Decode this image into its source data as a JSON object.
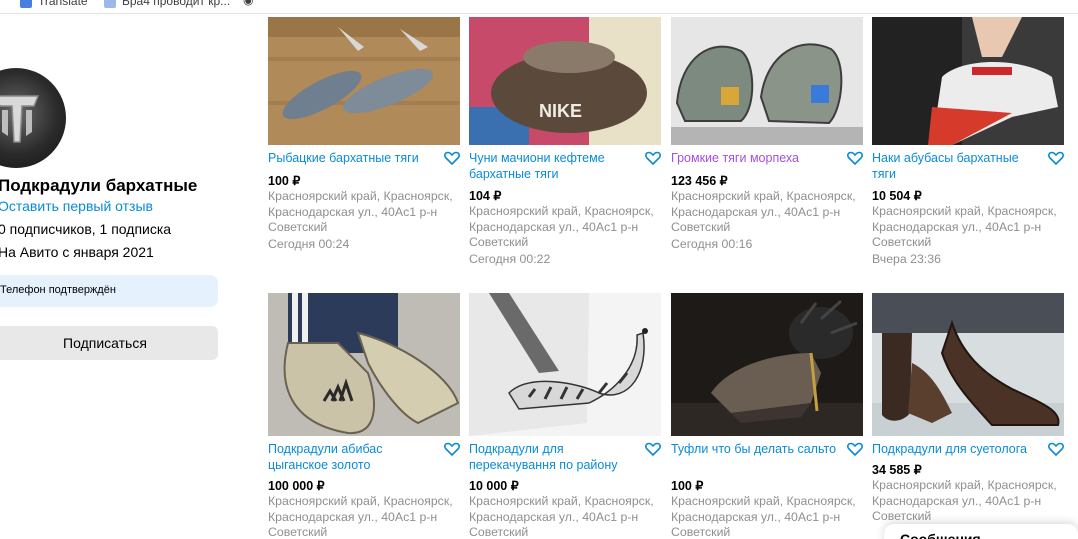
{
  "bookmarks": [
    "Translate",
    "Бра4 проводит кр..."
  ],
  "seller": {
    "name": "Подкрадули бархатные",
    "review_link": "Оставить первый отзыв",
    "followers": "0 подписчиков, 1 подписка",
    "since": "На Авито с января 2021",
    "phone_badge": "Телефон подтверждён",
    "subscribe_label": "Подписаться"
  },
  "colors": {
    "link": "#0a8bd8",
    "visited": "#a44fe0",
    "muted": "#8f8f8f",
    "badge_bg": "#e5f2fd"
  },
  "items": [
    {
      "title": "Рыбацкие бархатные тяги",
      "price": "100 ₽",
      "address": "Красноярский край, Красноярск, Краснодарская ул., 40Ас1 р-н Советский",
      "date": "Сегодня 00:24",
      "image": "fish-flipflops"
    },
    {
      "title": "Чуни мачиони кефтеме бархатные тяги",
      "price": "104 ₽",
      "address": "Красноярский край, Красноярск, Краснодарская ул., 40Ас1 р-н Советский",
      "date": "Сегодня 00:22",
      "image": "felt-nike-slippers"
    },
    {
      "title": "Громкие тяги морпеха",
      "price": "123 456 ₽",
      "address": "Красноярский край, Красноярск, Краснодарская ул., 40Ас1 р-н Советский",
      "date": "Сегодня 00:16",
      "image": "metal-shoes"
    },
    {
      "title": "Наки абубасы бархатные тяги",
      "price": "10 504 ₽",
      "address": "Красноярский край, Красноярск, Краснодарская ул., 40Ас1 р-н Советский",
      "date": "Вчера 23:36",
      "image": "red-heel-sneakers"
    },
    {
      "title": "Подкрадули абибас цыганское золото",
      "price": "100 000 ₽",
      "address": "Красноярский край, Красноярск, Краснодарская ул., 40Ас1 р-н Советский",
      "date": "",
      "image": "gold-adidas-shoes"
    },
    {
      "title": "Подкрадули для перекачування по району",
      "price": "10 000 ₽",
      "address": "Красноярский край, Красноярск, Краснодарская ул., 40Ас1 р-н Советский",
      "date": "",
      "image": "curled-zebra-shoe"
    },
    {
      "title": "Туфли что бы делать сальто",
      "price": "100 ₽",
      "address": "Красноярский край, Красноярск, Краснодарская ул., 40Ас1 р-н Советский",
      "date": "",
      "image": "fur-heel-shoe"
    },
    {
      "title": "Подкрадули для суетолога",
      "price": "34 585 ₽",
      "address": "Красноярский край, Красноярск, Краснодарская ул., 40Ас1 р-н Советский",
      "date": "",
      "image": "long-brown-shoes"
    }
  ],
  "messages_label": "Сообщения"
}
